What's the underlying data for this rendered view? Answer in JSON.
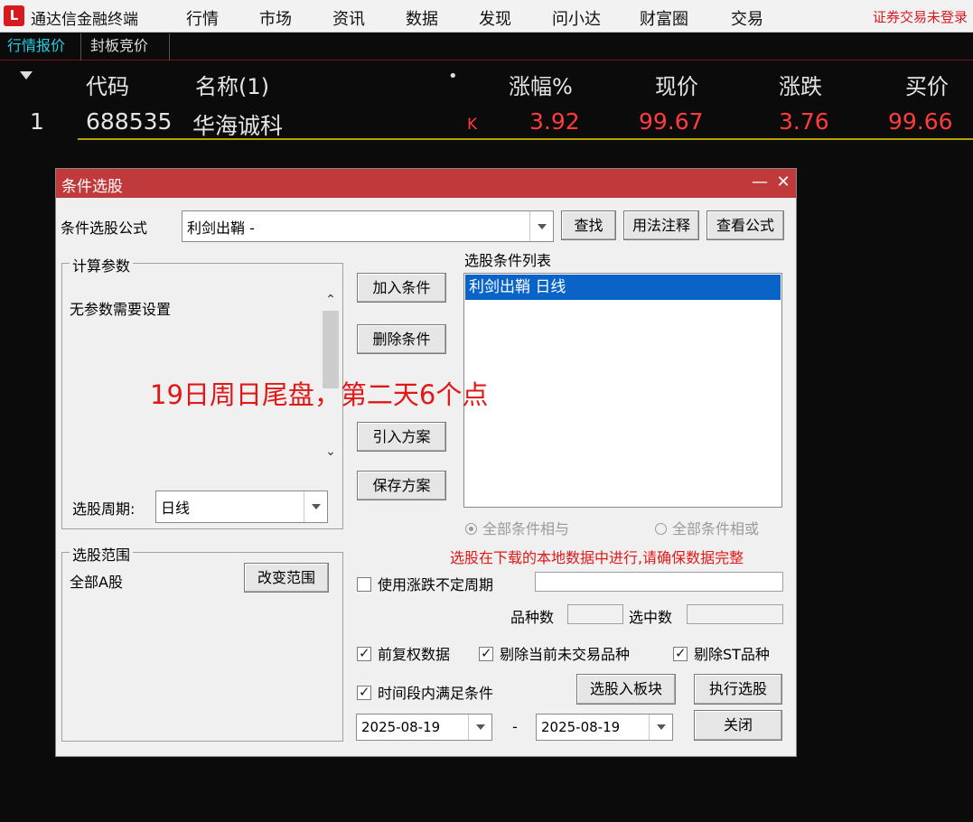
{
  "app": {
    "logo_glyph": "L",
    "title": "通达信金融终端",
    "menu": [
      "行情",
      "市场",
      "资讯",
      "数据",
      "发现",
      "问小达",
      "财富圈",
      "交易"
    ],
    "login_status": "证券交易未登录"
  },
  "tabs": [
    {
      "label": "行情报价",
      "active": true
    },
    {
      "label": "封板竞价",
      "active": false
    }
  ],
  "quote_table": {
    "headers": {
      "code": "代码",
      "name": "名称(1)",
      "dot": "•",
      "change_pct": "涨幅%",
      "price": "现价",
      "change": "涨跌",
      "bid": "买价"
    },
    "rows": [
      {
        "index": "1",
        "code": "688535",
        "name": "华海诚科",
        "flag": "K",
        "change_pct": "3.92",
        "price": "99.67",
        "change": "3.76",
        "bid": "99.66"
      }
    ],
    "colors": {
      "up": "#ff3b3b",
      "text": "#e5e5e5",
      "flag": "#ff3b3b"
    }
  },
  "dialog": {
    "title": "条件选股",
    "formula_label": "条件选股公式",
    "formula_value": "利剑出鞘  -",
    "find_button": "查找",
    "usage_button": "用法注释",
    "view_formula_button": "查看公式",
    "params_group": "计算参数",
    "params_text": "无参数需要设置",
    "period_label": "选股周期:",
    "period_value": "日线",
    "add_condition": "加入条件",
    "delete_condition": "删除条件",
    "import_plan": "引入方案",
    "save_plan": "保存方案",
    "condition_list_label": "选股条件列表",
    "condition_items": [
      "利剑出鞘  日线"
    ],
    "radio_and": "全部条件相与",
    "radio_or": "全部条件相或",
    "warning": "选股在下载的本地数据中进行,请确保数据完整",
    "use_variable_period": "使用涨跌不定周期",
    "variety_count_label": "品种数",
    "selected_count_label": "选中数",
    "scope_group": "选股范围",
    "scope_value": "全部A股",
    "change_scope": "改变范围",
    "forward_adjust": "前复权数据",
    "exclude_untraded": "剔除当前未交易品种",
    "exclude_st": "剔除ST品种",
    "within_period": "时间段内满足条件",
    "to_block": "选股入板块",
    "execute": "执行选股",
    "date_from": "2025-08-19",
    "date_sep": "-",
    "date_to": "2025-08-19",
    "close": "关闭",
    "window_min": "—",
    "window_close": "✕"
  },
  "annotation": "19日周日尾盘，第二天6个点"
}
